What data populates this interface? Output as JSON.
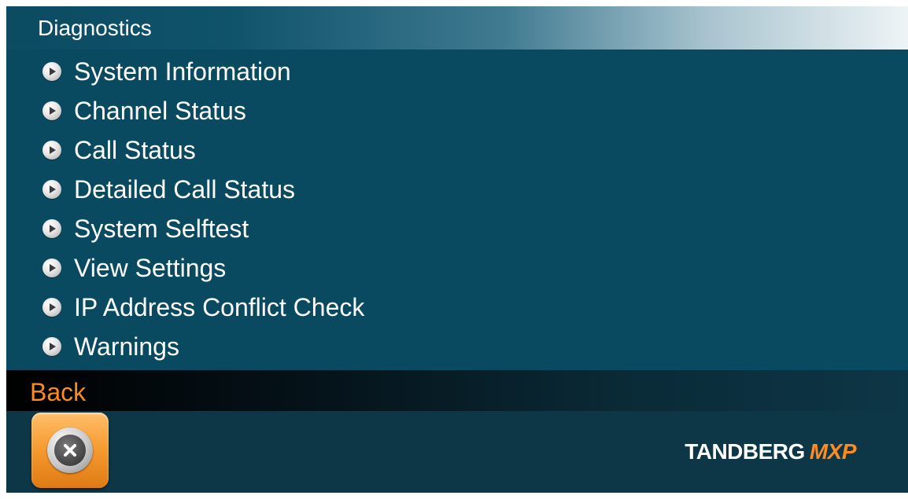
{
  "header": {
    "title": "Diagnostics"
  },
  "menu": {
    "items": [
      {
        "label": "System Information",
        "icon": "play-arrow-icon"
      },
      {
        "label": "Channel Status",
        "icon": "play-arrow-icon"
      },
      {
        "label": "Call Status",
        "icon": "play-arrow-icon"
      },
      {
        "label": "Detailed Call Status",
        "icon": "play-arrow-icon"
      },
      {
        "label": "System Selftest",
        "icon": "play-arrow-icon"
      },
      {
        "label": "View Settings",
        "icon": "play-arrow-icon"
      },
      {
        "label": "IP Address Conflict Check",
        "icon": "play-arrow-icon"
      },
      {
        "label": "Warnings",
        "icon": "play-arrow-icon"
      }
    ]
  },
  "back_bar": {
    "label": "Back"
  },
  "footer": {
    "close_icon": "close-x-icon",
    "brand_name": "TANDBERG",
    "brand_suffix": "MXP"
  },
  "colors": {
    "background": "#0a4a60",
    "accent": "#ff8a1e",
    "text": "#ffffff"
  }
}
